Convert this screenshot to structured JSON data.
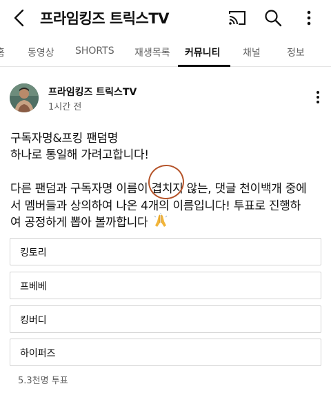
{
  "header": {
    "channel_title": "프라임킹즈 트릭스TV"
  },
  "tabs": [
    {
      "label": "홈"
    },
    {
      "label": "동영상"
    },
    {
      "label": "SHORTS"
    },
    {
      "label": "재생목록"
    },
    {
      "label": "커뮤니티",
      "active": true
    },
    {
      "label": "채널"
    },
    {
      "label": "정보"
    }
  ],
  "post": {
    "author": "프라임킹즈 트릭스TV",
    "time": "1시간 전",
    "lines": [
      "구독자명&프킹 팬덤명",
      "하나로  통일해 가려고합니다!",
      "다른 팬덤과 구독자명 이름이 겹치지 않는, 댓글 천이백개 중에",
      "서 멤버들과 상의하여 나온 4개의 이름입니다! 투표로 진행하",
      "여 공정하게 뽑아 볼까합니다"
    ],
    "emoji": "🙏"
  },
  "poll": {
    "options": [
      {
        "label": "킹토리"
      },
      {
        "label": "프베베"
      },
      {
        "label": "킹버디"
      },
      {
        "label": "하이퍼즈"
      }
    ],
    "vote_count": "5.3천명 투표"
  },
  "colors": {
    "text": "#0f0f0f",
    "secondary_text": "#606060",
    "border": "#d3d3d3",
    "annotation_circle": "#b5542a"
  },
  "icons": [
    "back-arrow-icon",
    "cast-icon",
    "search-icon",
    "more-vert-icon"
  ]
}
